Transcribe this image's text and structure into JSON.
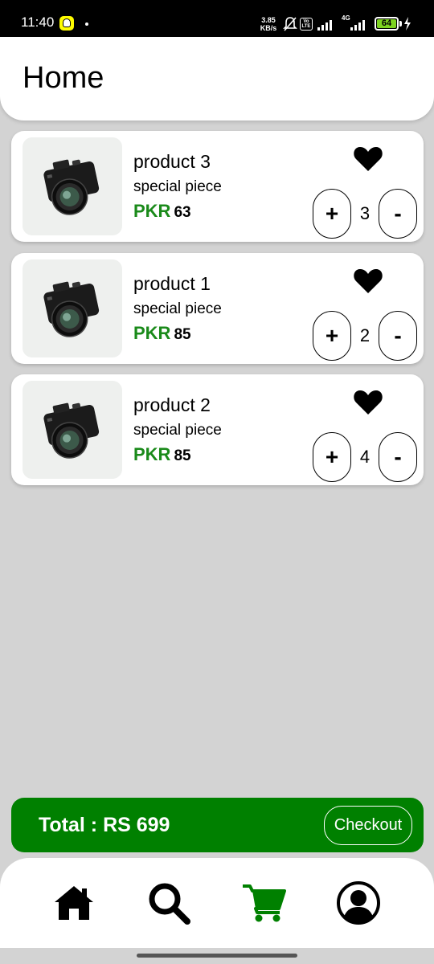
{
  "status_bar": {
    "time": "11:40",
    "net_speed_value": "3.85",
    "net_speed_unit": "KB/s",
    "volte": "Vo LTE",
    "network_type": "4G",
    "battery_level": "64"
  },
  "header": {
    "title": "Home"
  },
  "products": [
    {
      "name": "product 3",
      "subtitle": "special piece",
      "currency": "PKR",
      "price": "63",
      "quantity": "3",
      "plus_label": "+",
      "minus_label": "-",
      "favorite": true
    },
    {
      "name": "product 1",
      "subtitle": "special piece",
      "currency": "PKR",
      "price": "85",
      "quantity": "2",
      "plus_label": "+",
      "minus_label": "-",
      "favorite": true
    },
    {
      "name": "product 2",
      "subtitle": "special piece",
      "currency": "PKR",
      "price": "85",
      "quantity": "4",
      "plus_label": "+",
      "minus_label": "-",
      "favorite": true
    }
  ],
  "checkout": {
    "total_text": "Total :  RS 699",
    "button_label": "Checkout"
  },
  "bottom_nav": [
    {
      "icon": "home-icon",
      "active": false
    },
    {
      "icon": "search-icon",
      "active": false
    },
    {
      "icon": "cart-icon",
      "active": true
    },
    {
      "icon": "user-profile-icon",
      "active": false
    }
  ],
  "colors": {
    "accent": "#008000",
    "price_green": "#1a8a1a",
    "background": "#d3d3d3"
  }
}
